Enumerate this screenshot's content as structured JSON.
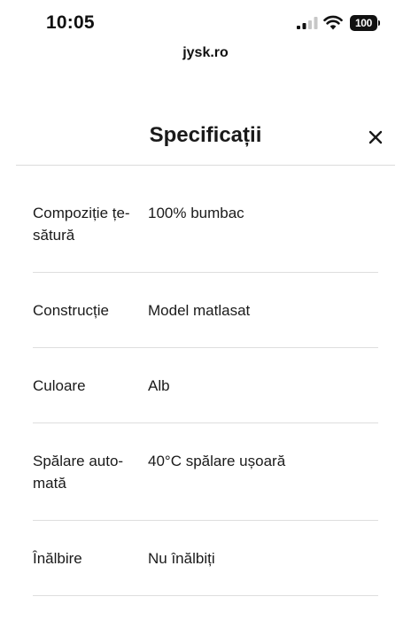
{
  "status_bar": {
    "time": "10:05",
    "battery": "100",
    "icons": [
      "signal-icon",
      "wifi-icon",
      "battery-icon"
    ]
  },
  "browser": {
    "url": "jysk.ro"
  },
  "sheet": {
    "title": "Specificații",
    "close_icon": "close-icon"
  },
  "specs": [
    {
      "label": "Compoziție țe-\nsătură",
      "value": "100% bumbac"
    },
    {
      "label": "Construcție",
      "value": "Model matlasat"
    },
    {
      "label": "Culoare",
      "value": "Alb"
    },
    {
      "label": "Spălare auto-\nmată",
      "value": "40°C spălare ușoară"
    },
    {
      "label": "Înălbire",
      "value": "Nu înălbiți"
    }
  ],
  "colors": {
    "text": "#1a1a1a",
    "divider": "#dedede",
    "background": "#ffffff"
  }
}
